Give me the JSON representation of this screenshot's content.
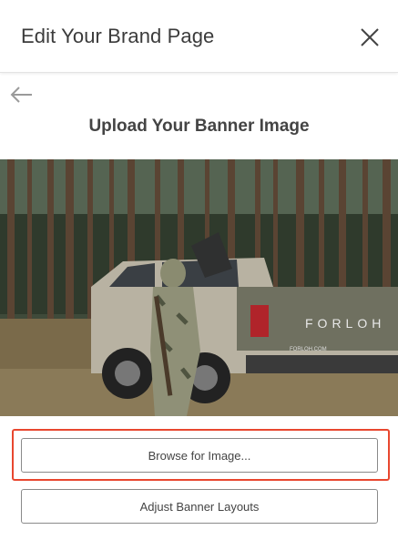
{
  "header": {
    "title": "Edit Your Brand Page"
  },
  "main": {
    "section_title": "Upload Your Banner Image",
    "banner": {
      "truck_brand_text": "FORLOH",
      "truck_url_text": "FORLOH.COM"
    },
    "buttons": {
      "browse_label": "Browse for Image...",
      "adjust_label": "Adjust Banner Layouts"
    }
  },
  "colors": {
    "highlight": "#e8472f",
    "title_text": "#3b3b3b"
  },
  "icons": {
    "close": "close-icon",
    "back": "arrow-left-icon"
  }
}
